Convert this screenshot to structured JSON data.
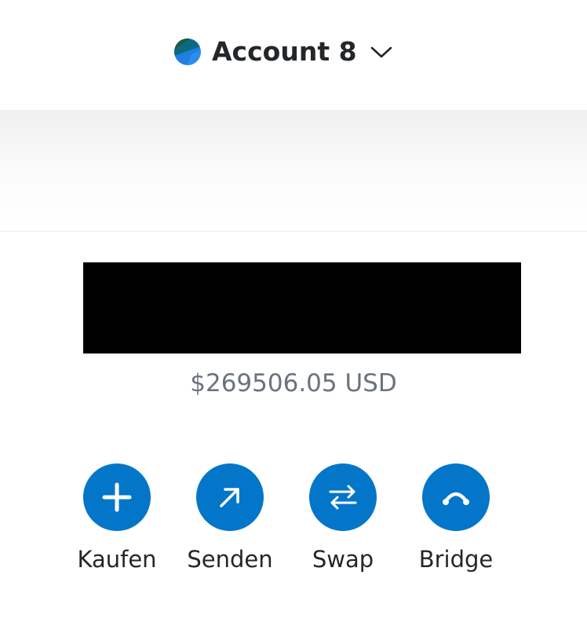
{
  "header": {
    "account_name": "Account 8",
    "account_avatar_icon": "jazzicon-avatar",
    "chevron_icon": "chevron-down-icon"
  },
  "balance": {
    "primary_value_hidden": true,
    "fiat": "$269506.05 USD"
  },
  "actions": [
    {
      "label": "Kaufen",
      "icon": "plus-icon"
    },
    {
      "label": "Senden",
      "icon": "arrow-up-right-icon"
    },
    {
      "label": "Swap",
      "icon": "swap-arrows-icon"
    },
    {
      "label": "Bridge",
      "icon": "bridge-icon"
    }
  ],
  "colors": {
    "accent": "#0376c9",
    "text_primary": "#24272a",
    "text_secondary": "#6a737d"
  }
}
